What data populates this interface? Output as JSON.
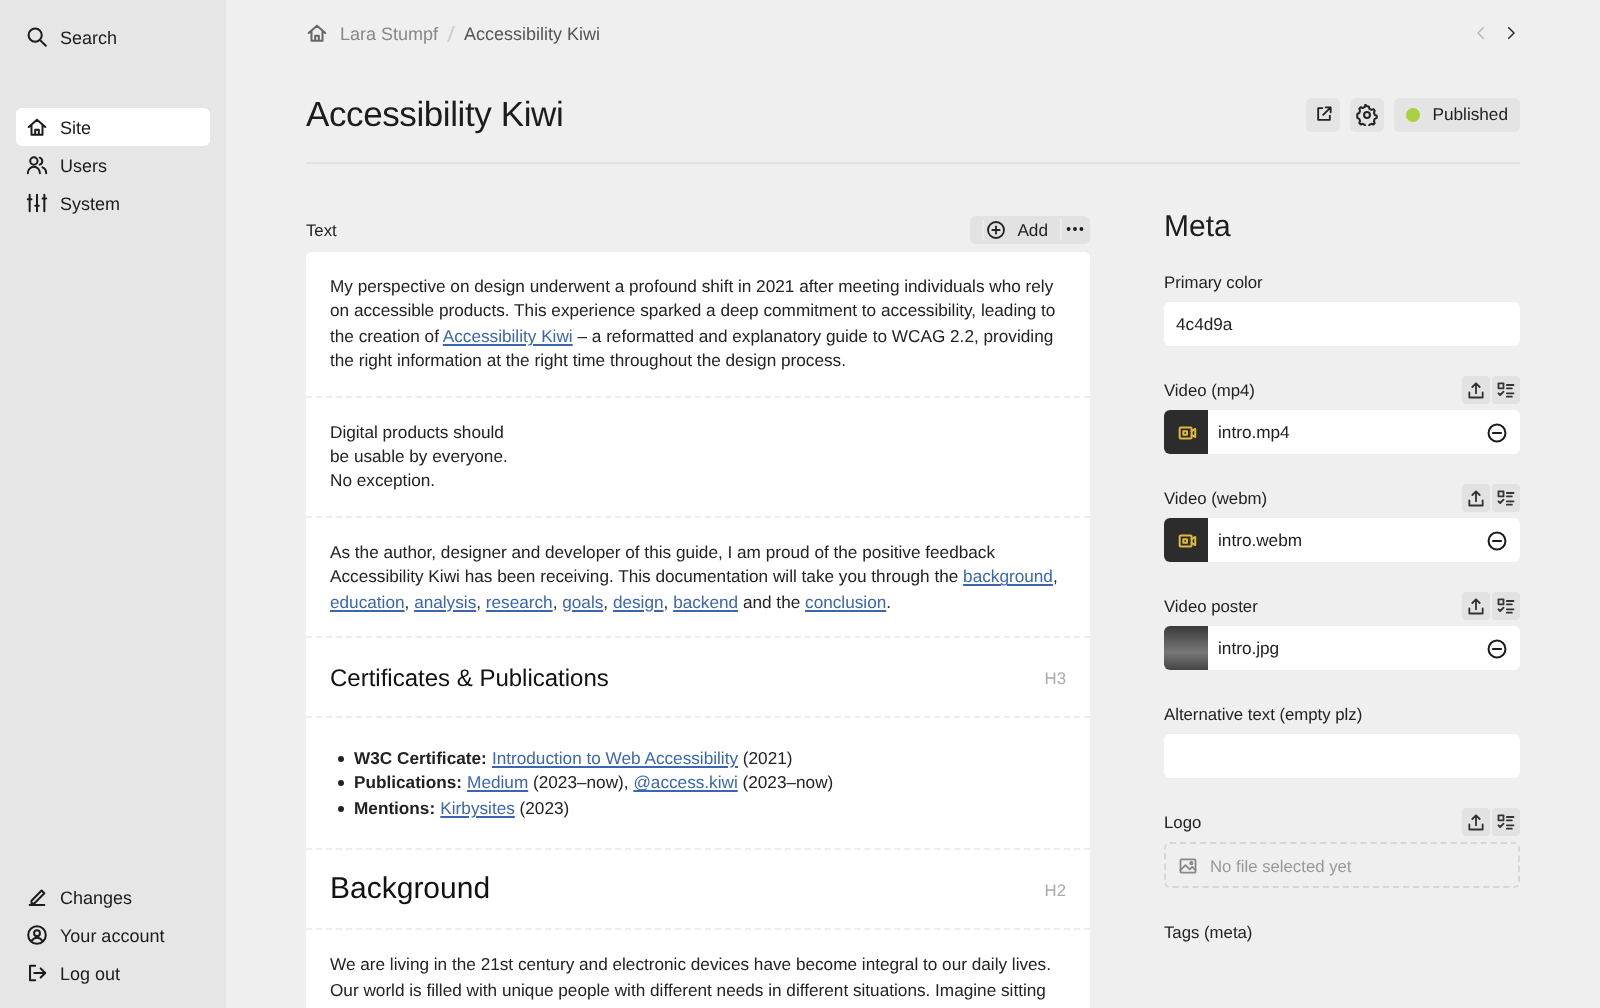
{
  "sidebar": {
    "search": {
      "label": "Search"
    },
    "menu": [
      {
        "label": "Site",
        "selected": true
      },
      {
        "label": "Users",
        "selected": false
      },
      {
        "label": "System",
        "selected": false
      }
    ],
    "footer": [
      {
        "label": "Changes"
      },
      {
        "label": "Your account"
      },
      {
        "label": "Log out"
      }
    ]
  },
  "breadcrumb": [
    "Lara Stumpf",
    "Accessibility Kiwi"
  ],
  "page": {
    "title": "Accessibility Kiwi",
    "status": {
      "label": "Published"
    }
  },
  "text_field": {
    "label": "Text",
    "add_button": "Add",
    "blocks": [
      {
        "kind": "paragraph",
        "segments": [
          {
            "kind": "plain",
            "text": "My perspective on design underwent a profound shift in 2021 after meeting individuals who rely on accessible products. This experience sparked a deep commitment to accessibility, leading to the creation of "
          },
          {
            "kind": "link",
            "text": "Accessibility Kiwi"
          },
          {
            "kind": "plain",
            "text": " – a reformatted and explanatory guide to WCAG 2.2, providing the right information at the right time throughout the design process."
          }
        ]
      },
      {
        "kind": "paragraph",
        "segments": [
          {
            "kind": "plain",
            "text": "Digital products should\nbe usable by everyone.\nNo exception."
          }
        ]
      },
      {
        "kind": "paragraph",
        "segments": [
          {
            "kind": "plain",
            "text": "As the author, designer and developer of this guide, I am proud of the positive feedback Accessibility Kiwi has been receiving. This documentation will take you through the "
          },
          {
            "kind": "link",
            "text": "background"
          },
          {
            "kind": "plain",
            "text": ", "
          },
          {
            "kind": "link",
            "text": "education"
          },
          {
            "kind": "plain",
            "text": ", "
          },
          {
            "kind": "link",
            "text": "analysis"
          },
          {
            "kind": "plain",
            "text": ", "
          },
          {
            "kind": "link",
            "text": "research"
          },
          {
            "kind": "plain",
            "text": ", "
          },
          {
            "kind": "link",
            "text": "goals"
          },
          {
            "kind": "plain",
            "text": ", "
          },
          {
            "kind": "link",
            "text": "design"
          },
          {
            "kind": "plain",
            "text": ", "
          },
          {
            "kind": "link",
            "text": "backend"
          },
          {
            "kind": "plain",
            "text": " and the "
          },
          {
            "kind": "link",
            "text": "conclusion"
          },
          {
            "kind": "plain",
            "text": "."
          }
        ]
      },
      {
        "kind": "heading",
        "text": "Certificates & Publications",
        "level": "H3"
      },
      {
        "kind": "list",
        "items": [
          [
            {
              "kind": "bold",
              "text": "W3C Certificate:"
            },
            {
              "kind": "link",
              "text": "Introduction to Web Accessibility"
            },
            {
              "kind": "plain",
              "text": " (2021)"
            }
          ],
          [
            {
              "kind": "bold",
              "text": "Publications:"
            },
            {
              "kind": "link",
              "text": "Medium"
            },
            {
              "kind": "plain",
              "text": " (2023–now), "
            },
            {
              "kind": "link",
              "text": "@access.kiwi"
            },
            {
              "kind": "plain",
              "text": " (2023–now)"
            }
          ],
          [
            {
              "kind": "bold",
              "text": "Mentions:"
            },
            {
              "kind": "link",
              "text": "Kirbysites"
            },
            {
              "kind": "plain",
              "text": " (2023)"
            }
          ]
        ]
      },
      {
        "kind": "heading",
        "text": "Background",
        "level": "H2"
      },
      {
        "kind": "paragraph",
        "segments": [
          {
            "kind": "plain",
            "text": "We are living in the 21st century and electronic devices have become integral to our daily lives. Our world is filled with unique people with different needs in different situations. Imagine sitting"
          }
        ]
      }
    ]
  },
  "meta": {
    "title": "Meta",
    "fields": [
      {
        "kind": "text",
        "label": "Primary color",
        "value": "4c4d9a"
      },
      {
        "kind": "files",
        "label": "Video (mp4)",
        "files": [
          {
            "name": "intro.mp4",
            "kind": "video"
          }
        ]
      },
      {
        "kind": "files",
        "label": "Video (webm)",
        "files": [
          {
            "name": "intro.webm",
            "kind": "video"
          }
        ]
      },
      {
        "kind": "files",
        "label": "Video poster",
        "files": [
          {
            "name": "intro.jpg",
            "kind": "image"
          }
        ]
      },
      {
        "kind": "text",
        "label": "Alternative text (empty plz)"
      },
      {
        "kind": "files",
        "label": "Logo",
        "placeholder": "No file selected yet"
      },
      {
        "kind": "tags",
        "label": "Tags (meta)"
      }
    ]
  }
}
